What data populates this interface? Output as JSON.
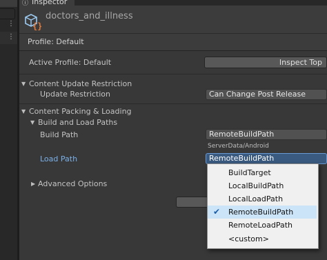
{
  "tab": {
    "label": "Inspector"
  },
  "asset": {
    "name": "doctors_and_illness"
  },
  "profile_bar": {
    "text": "Profile: Default"
  },
  "active_profile": {
    "label": "Active Profile: Default",
    "button": "Inspect Top"
  },
  "content_update": {
    "header": "Content Update Restriction",
    "field_label": "Update Restriction",
    "value": "Can Change Post Release"
  },
  "content_packing": {
    "header": "Content Packing & Loading",
    "build_load_paths": "Build and Load Paths",
    "build_path_label": "Build Path",
    "build_path_value": "RemoteBuildPath",
    "build_path_resolved": "ServerData/Android",
    "load_path_label": "Load Path",
    "load_path_value": "RemoteBuildPath",
    "advanced": "Advanced Options"
  },
  "dropdown": {
    "selected": "RemoteBuildPath",
    "items": [
      "BuildTarget",
      "LocalBuildPath",
      "LocalLoadPath",
      "RemoteBuildPath",
      "RemoteLoadPath",
      "<custom>"
    ]
  },
  "colors": {
    "accent": "#3a79bb",
    "load_path_label": "#7ab0e8",
    "panel_bg": "#383838",
    "menu_bg": "#f0f0f0",
    "menu_selected": "#cce4f7"
  }
}
